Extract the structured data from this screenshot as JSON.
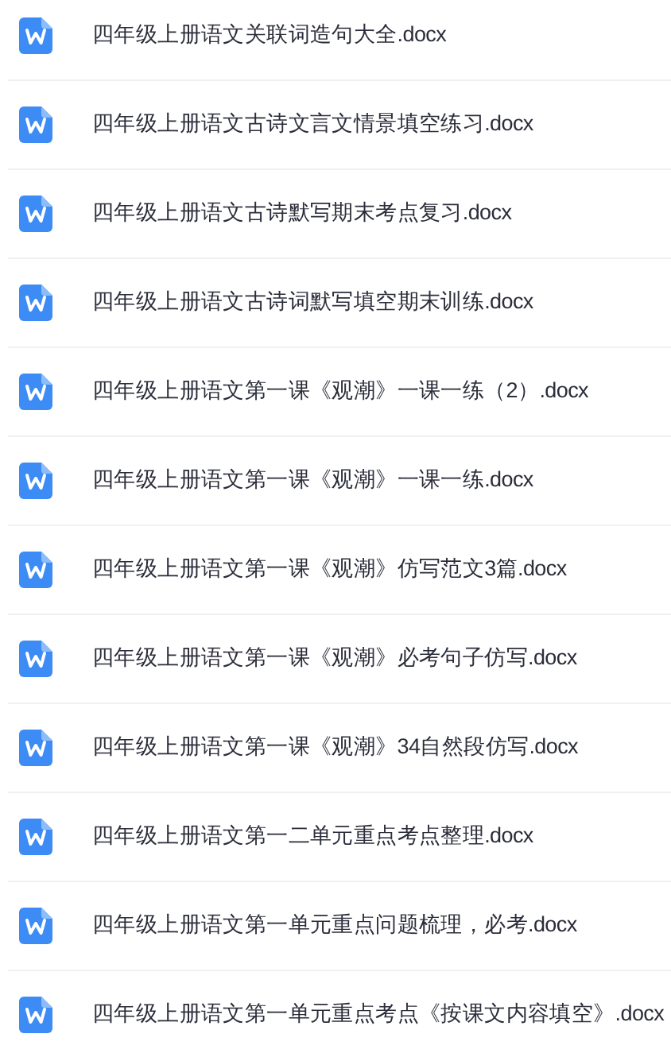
{
  "files": [
    {
      "name": "四年级上册语文关联词造句大全.docx"
    },
    {
      "name": "四年级上册语文古诗文言文情景填空练习.docx"
    },
    {
      "name": "四年级上册语文古诗默写期末考点复习.docx"
    },
    {
      "name": "四年级上册语文古诗词默写填空期末训练.docx"
    },
    {
      "name": "四年级上册语文第一课《观潮》一课一练（2）.docx"
    },
    {
      "name": "四年级上册语文第一课《观潮》一课一练.docx"
    },
    {
      "name": "四年级上册语文第一课《观潮》仿写范文3篇.docx"
    },
    {
      "name": "四年级上册语文第一课《观潮》必考句子仿写.docx"
    },
    {
      "name": "四年级上册语文第一课《观潮》34自然段仿写.docx"
    },
    {
      "name": "四年级上册语文第一二单元重点考点整理.docx"
    },
    {
      "name": "四年级上册语文第一单元重点问题梳理，必考.docx"
    },
    {
      "name": "四年级上册语文第一单元重点考点《按课文内容填空》.docx"
    }
  ]
}
